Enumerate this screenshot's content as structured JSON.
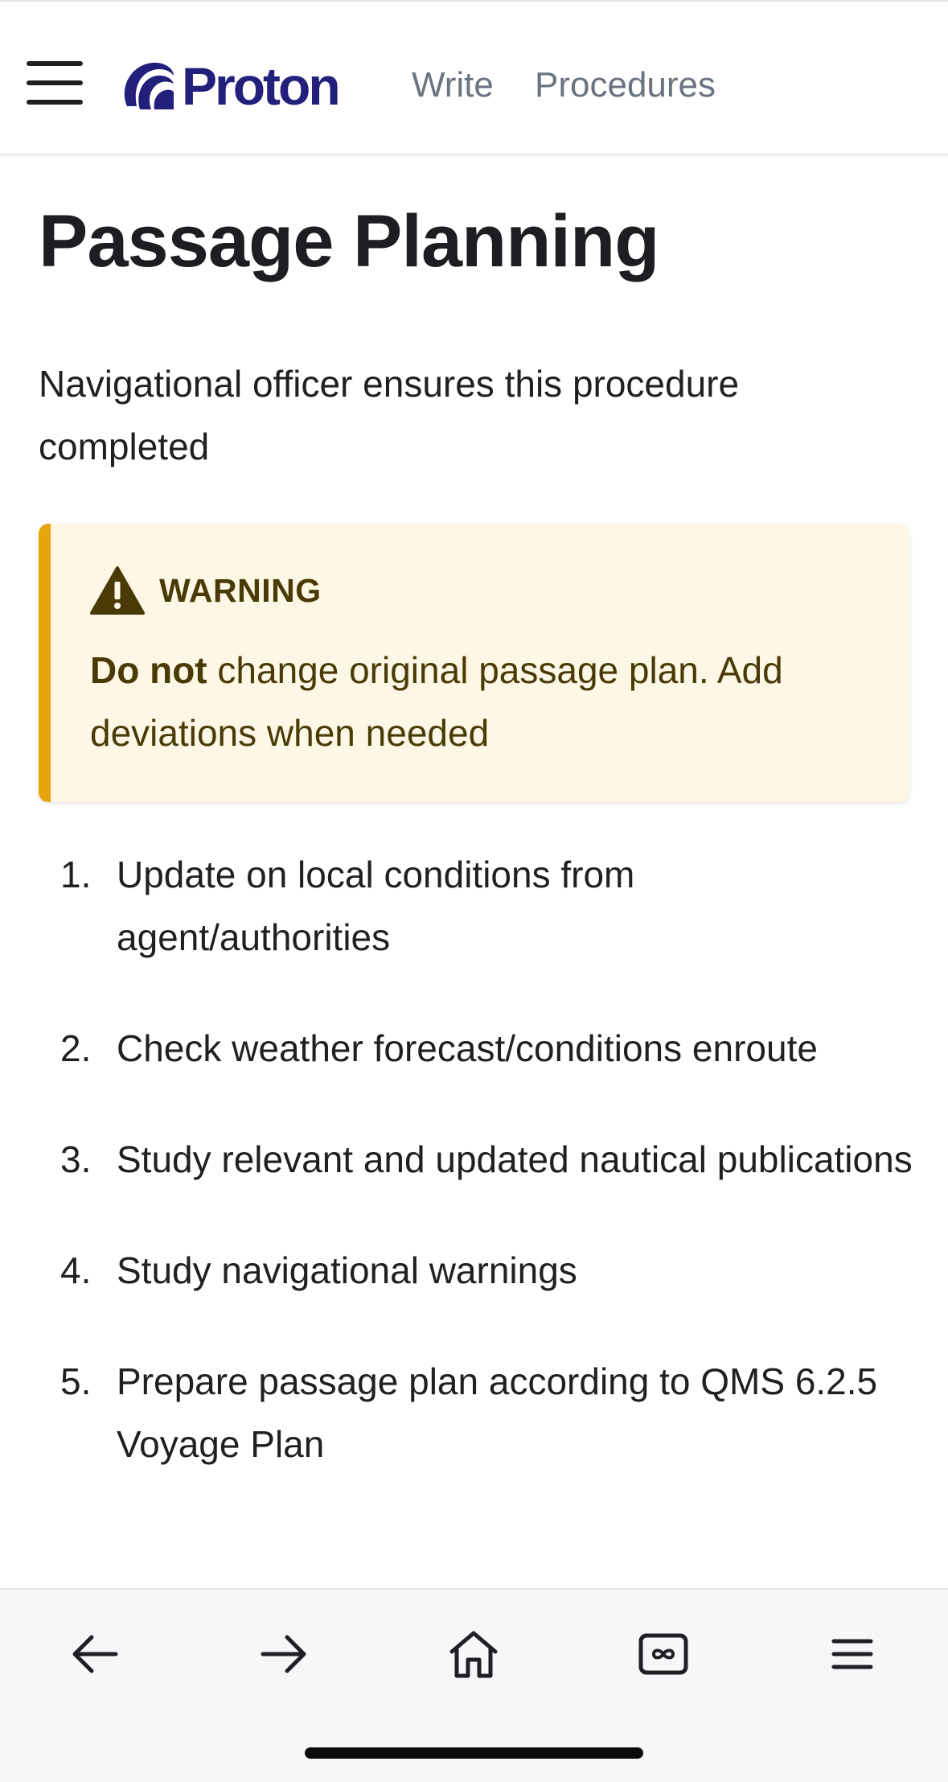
{
  "header": {
    "logo_text": "Proton",
    "nav": {
      "write": "Write",
      "procedures": "Procedures"
    }
  },
  "page": {
    "title": "Passage Planning",
    "subtitle": "Navigational officer ensures this procedure completed"
  },
  "warning": {
    "title": "WARNING",
    "emphasis": "Do not",
    "message": " change original passage plan. Add deviations when needed"
  },
  "steps": [
    {
      "num": "1.",
      "text": "Update on local conditions from agent/authorities"
    },
    {
      "num": "2.",
      "text": "Check weather forecast/conditions enroute"
    },
    {
      "num": "3.",
      "text": "Study relevant and updated nautical publications"
    },
    {
      "num": "4.",
      "text": "Study navigational warnings"
    },
    {
      "num": "5.",
      "text": "Prepare passage plan according to QMS 6.2.5 Voyage Plan"
    }
  ],
  "toolbar": {
    "icons": [
      "back-arrow-icon",
      "forward-arrow-icon",
      "home-icon",
      "tabs-icon",
      "menu-icon"
    ]
  },
  "colors": {
    "brand": "#22207a",
    "warning_accent": "#e8a40c",
    "warning_background": "#fef7e6",
    "warning_text": "#4a3a05",
    "nav_text": "#6b7280"
  }
}
